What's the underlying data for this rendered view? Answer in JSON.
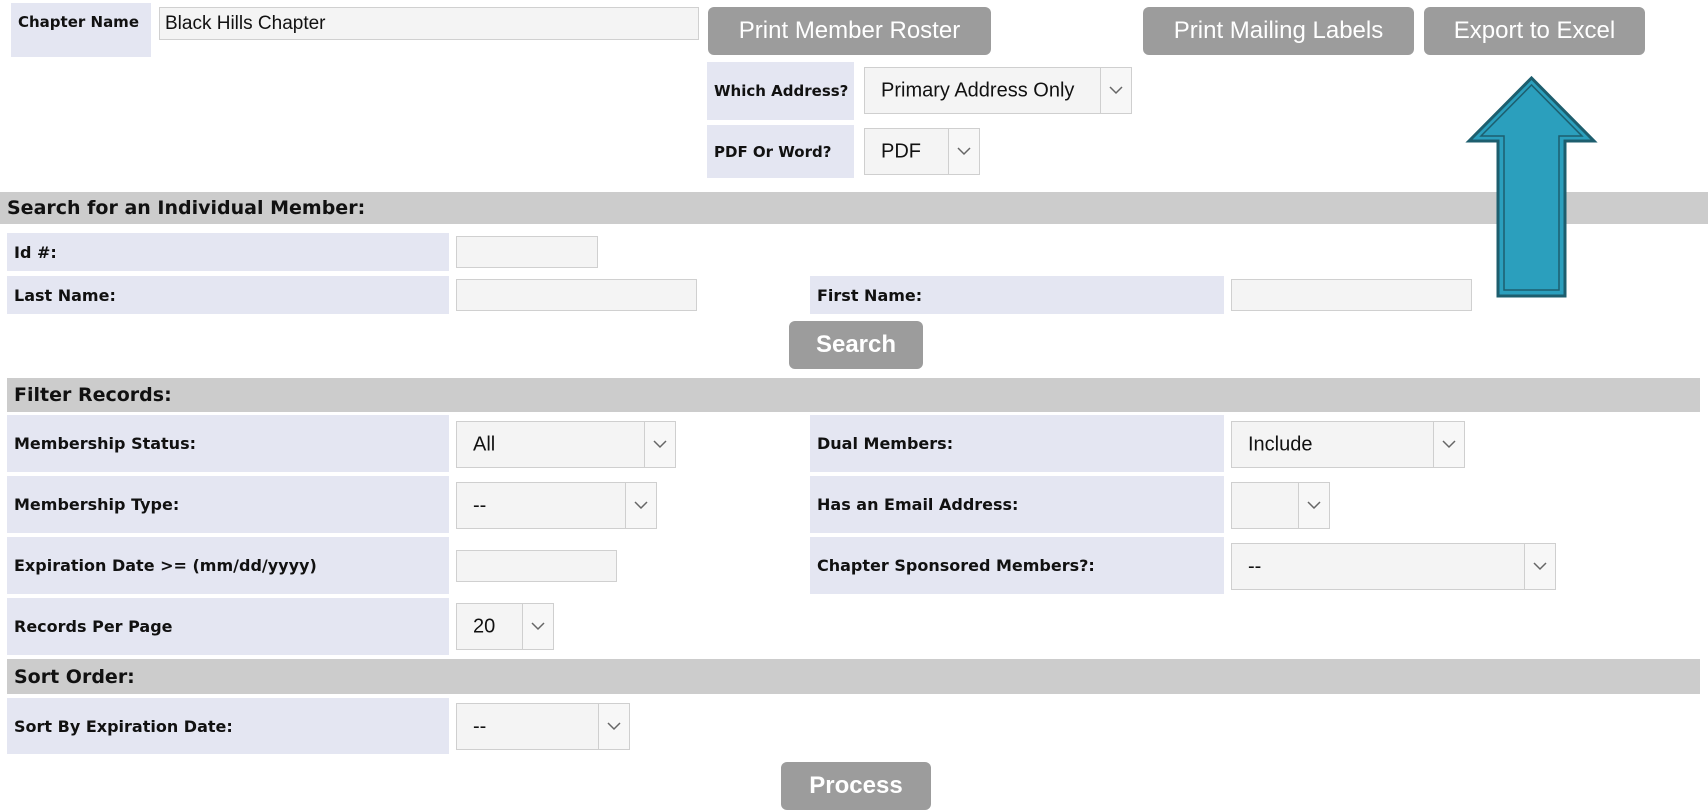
{
  "chapter": {
    "label": "Chapter Name",
    "value": "Black Hills Chapter"
  },
  "toolbar": {
    "print_roster": "Print Member Roster",
    "print_labels": "Print Mailing Labels",
    "export_excel": "Export to Excel"
  },
  "roster_options": {
    "which_address_label": "Which Address?",
    "which_address_value": "Primary Address Only",
    "format_label": "PDF Or Word?",
    "format_value": "PDF"
  },
  "search_section": {
    "heading": "Search for an Individual Member:",
    "id_label": "Id #:",
    "id_value": "",
    "last_name_label": "Last Name:",
    "last_name_value": "",
    "first_name_label": "First Name:",
    "first_name_value": "",
    "search_button": "Search"
  },
  "filter_section": {
    "heading": "Filter Records:",
    "membership_status_label": "Membership Status:",
    "membership_status_value": "All",
    "dual_members_label": "Dual Members:",
    "dual_members_value": "Include",
    "membership_type_label": "Membership Type:",
    "membership_type_value": "--",
    "has_email_label": "Has an Email Address:",
    "has_email_value": "",
    "expiration_label": "Expiration Date >= (mm/dd/yyyy)",
    "expiration_value": "",
    "chapter_sponsored_label": "Chapter Sponsored Members?:",
    "chapter_sponsored_value": "--",
    "records_per_page_label": "Records Per Page",
    "records_per_page_value": "20"
  },
  "sort_section": {
    "heading": "Sort Order:",
    "sort_expiration_label": "Sort By Expiration Date:",
    "sort_expiration_value": "--"
  },
  "process_button": "Process",
  "colors": {
    "label_bg": "#e4e6f2",
    "section_bar": "#cccccc",
    "button_bg": "#9c9c9c",
    "annotation_arrow": "#2b9fbd"
  },
  "icons": {
    "dropdown": "chevron-down-icon",
    "annotation": "up-arrow-icon"
  }
}
